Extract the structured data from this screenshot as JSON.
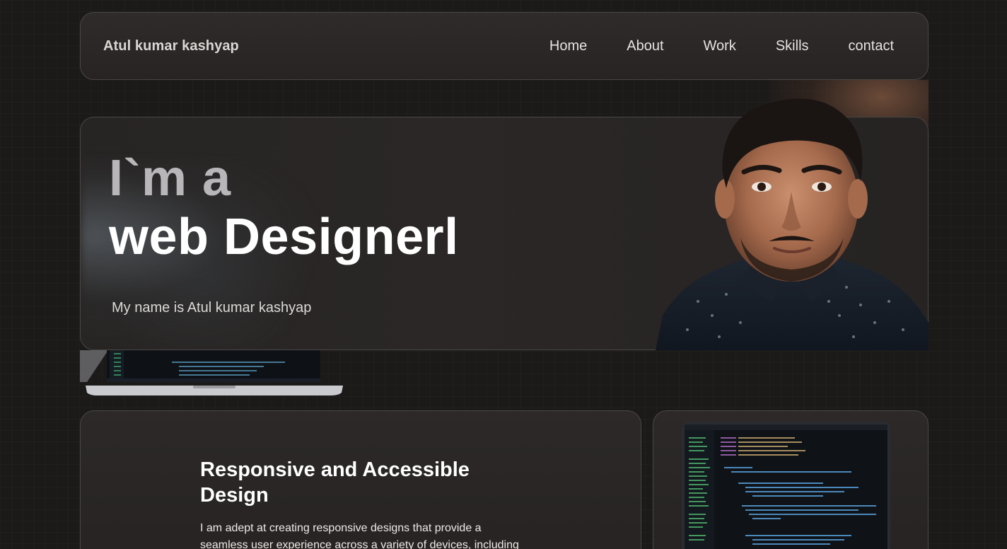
{
  "navbar": {
    "brand": "Atul kumar kashyap",
    "links": [
      "Home",
      "About",
      "Work",
      "Skills",
      "contact"
    ]
  },
  "hero": {
    "line1": "I`m a",
    "line2": "web Designerl",
    "subtitle": "My name is Atul kumar kashyap"
  },
  "feature": {
    "title": "Responsive and Accessible Design",
    "text": "I am adept at creating responsive designs that provide a seamless user experience across a variety of devices, including"
  },
  "colors": {
    "background": "#1c1a19",
    "card": "#2a2726",
    "border": "#4a4644",
    "text": "#ffffff",
    "muted": "#b8b6b8"
  },
  "icons": [
    "portrait-image",
    "laptop-code-image",
    "code-editor-image"
  ]
}
